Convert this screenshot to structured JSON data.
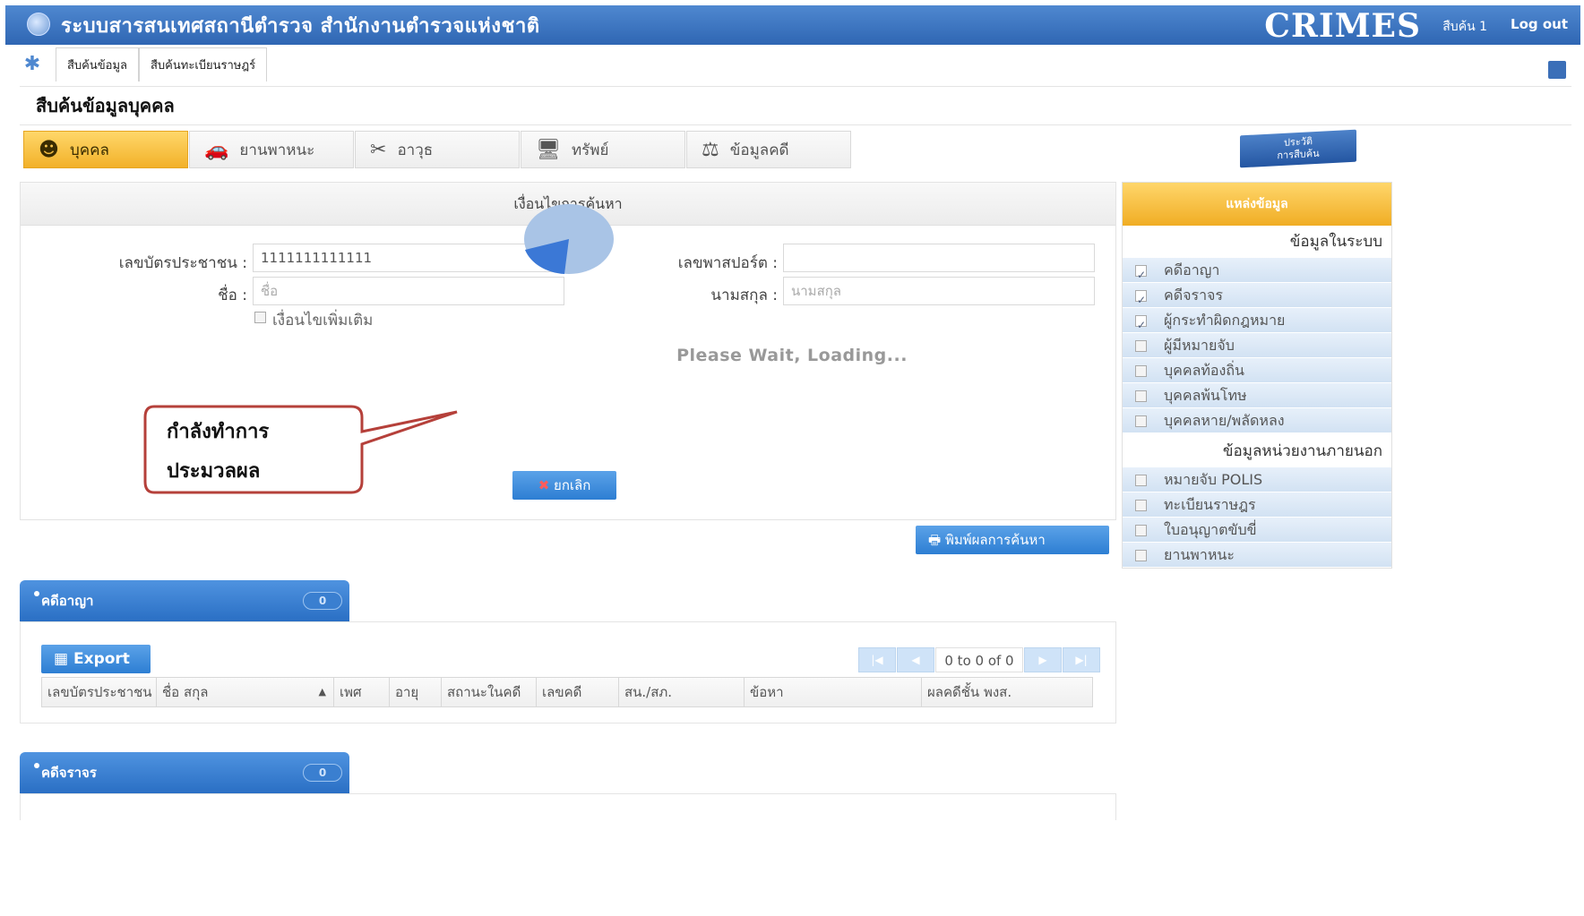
{
  "header": {
    "title": "ระบบสารสนเทศสถานีตำรวจ  สำนักงานตำรวจแห่งชาติ",
    "brand": "CRIMES",
    "user": "สืบค้น 1",
    "logout": "Log out"
  },
  "menu": [
    "สืบค้นข้อมูล",
    "สืบค้นทะเบียนราษฎร์"
  ],
  "section_title": "สืบค้นข้อมูลบุคคล",
  "tabs": [
    {
      "label": "บุคคล",
      "active": true
    },
    {
      "label": "ยานพาหนะ",
      "active": false
    },
    {
      "label": "อาวุธ",
      "active": false
    },
    {
      "label": "ทรัพย์",
      "active": false
    },
    {
      "label": "ข้อมูลคดี",
      "active": false
    }
  ],
  "history_button": {
    "line1": "ประวัติ",
    "line2": "การสืบค้น"
  },
  "search": {
    "heading": "เงื่อนไขการค้นหา",
    "id_label": "เลขบัตรประชาชน :",
    "id_value": "1111111111111",
    "passport_label": "เลขพาสปอร์ต :",
    "passport_value": "",
    "name_label": "ชื่อ :",
    "name_placeholder": "ชื่อ",
    "surname_label": "นามสกุล :",
    "surname_placeholder": "นามสกุล",
    "extra_label": "เงื่อนไขเพิ่มเติม",
    "loading_text": "Please Wait, Loading...",
    "cancel_label": "ยกเลิก",
    "print_label": "พิมพ์ผลการค้นหา"
  },
  "callout": {
    "line1": "กำลังทำการ",
    "line2": "ประมวลผล"
  },
  "sidebar": {
    "heading": "แหล่งข้อมูล",
    "group1": "ข้อมูลในระบบ",
    "items1": [
      {
        "label": "คดีอาญา",
        "checked": true
      },
      {
        "label": "คดีจราจร",
        "checked": true
      },
      {
        "label": "ผู้กระทำผิดกฎหมาย",
        "checked": true
      },
      {
        "label": "ผู้มีหมายจับ",
        "checked": false
      },
      {
        "label": "บุคคลท้องถิ่น",
        "checked": false
      },
      {
        "label": "บุคคลพ้นโทษ",
        "checked": false
      },
      {
        "label": "บุคคลหาย/พลัดหลง",
        "checked": false
      }
    ],
    "group2": "ข้อมูลหน่วยงานภายนอก",
    "items2": [
      {
        "label": "หมายจับ POLIS",
        "checked": false
      },
      {
        "label": "ทะเบียนราษฎร",
        "checked": false
      },
      {
        "label": "ใบอนุญาตขับขี่",
        "checked": false
      },
      {
        "label": "ยานพาหนะ",
        "checked": false
      }
    ]
  },
  "results": [
    {
      "title": "คดีอาญา",
      "count": "0"
    },
    {
      "title": "คดีจราจร",
      "count": "0"
    }
  ],
  "table": {
    "export_label": "Export",
    "pager_info": "0 to 0 of 0",
    "columns": [
      "เลขบัตรประชาชน",
      "ชื่อ สกุล",
      "เพศ",
      "อายุ",
      "สถานะในคดี",
      "เลขคดี",
      "สน./สภ.",
      "ข้อหา",
      "ผลคดีชั้น พงส."
    ]
  },
  "colors": {
    "primary": "#2f66b3",
    "accent": "#f2b129",
    "button": "#2d7ed3"
  }
}
